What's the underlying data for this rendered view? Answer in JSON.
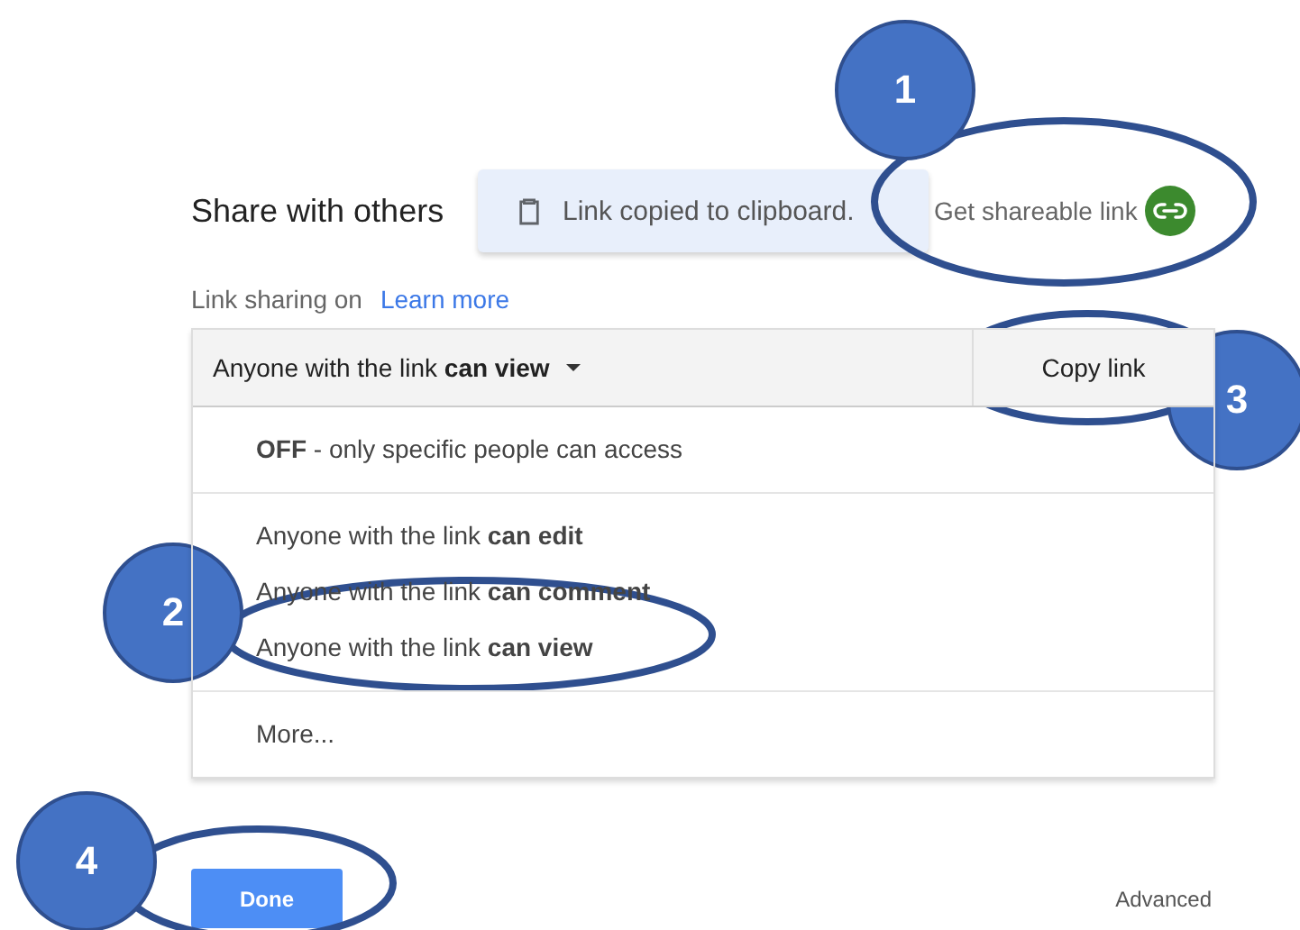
{
  "dialog": {
    "title": "Share with others",
    "toast": {
      "text": "Link copied to clipboard."
    },
    "shareable_link": {
      "label": "Get shareable link"
    },
    "link_sharing": {
      "status": "Link sharing on",
      "help_link": "Learn more"
    },
    "access_dropdown": {
      "value": "Anyone with the link **can view**",
      "expanded": true
    },
    "copy_button": "Copy link",
    "menu_groups": [
      [
        "**OFF** - only specific people can access"
      ],
      [
        "Anyone with the link **can edit**",
        "Anyone with the link **can comment**",
        "Anyone with the link **can view**"
      ],
      [
        "More..."
      ]
    ],
    "done_button": "Done",
    "advanced_link": "Advanced"
  },
  "callouts": [
    {
      "label": "1"
    },
    {
      "label": "2"
    },
    {
      "label": "3"
    },
    {
      "label": "4"
    }
  ]
}
